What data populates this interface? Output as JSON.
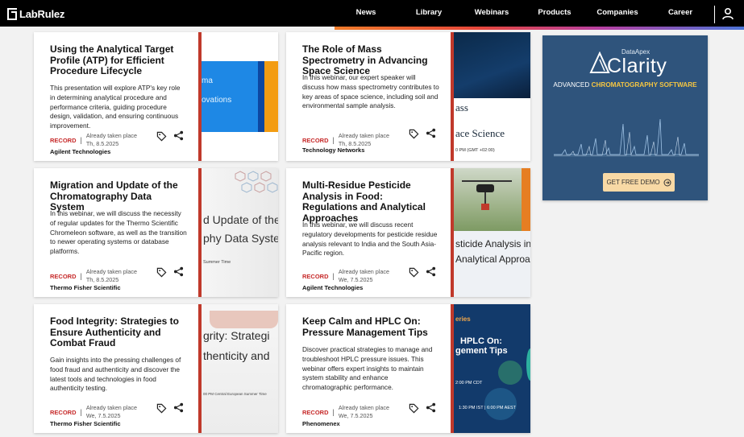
{
  "brand": {
    "name": "LabRulez"
  },
  "nav": {
    "items": [
      "News",
      "Library",
      "Webinars",
      "Products",
      "Companies",
      "Career"
    ]
  },
  "cards": [
    {
      "title": "Using the Analytical Target Profile (ATP) for Efficient Procedure Lifecycle",
      "description": "This presentation will explore ATP's key role in determining analytical procedure and performance criteria, guiding procedure design, validation, and ensuring continuous improvement.",
      "record": "RECORD",
      "taken": "Already taken place",
      "date": "Th, 8.5.2025",
      "company": "Agilent Technologies",
      "thumb": {
        "texts": [
          "ma",
          "ovations"
        ]
      }
    },
    {
      "title": "The Role of Mass Spectrometry in Advancing Space Science",
      "description": "In this webinar, our expert speaker will discuss how mass spectrometry contributes to key areas of space science, including soil and environmental sample analysis.",
      "record": "RECORD",
      "taken": "Already taken place",
      "date": "Th, 8.5.2025",
      "company": "Technology Networks",
      "thumb": {
        "texts": [
          "ass",
          "ace Science",
          "0 PM (GMT +02:00)"
        ]
      }
    },
    {
      "title": "Migration and Update of the Chromatography Data System",
      "description": "In this webinar, we will discuss the necessity of regular updates for the Thermo Scientific Chromeleon software, as well as the transition to newer operating systems or database platforms.",
      "record": "RECORD",
      "taken": "Already taken place",
      "date": "Th, 8.5.2025",
      "company": "Thermo Fisher Scientific",
      "thumb": {
        "texts": [
          "d Update of the",
          "phy Data Syster",
          "Summer Time"
        ]
      }
    },
    {
      "title": "Multi-Residue Pesticide Analysis in Food: Regulations and Analytical Approaches",
      "description": "In this webinar, we will discuss recent regulatory developments for pesticide residue analysis relevant to India and the South Asia-Pacific region.",
      "record": "RECORD",
      "taken": "Already taken place",
      "date": "We, 7.5.2025",
      "company": "Agilent Technologies",
      "thumb": {
        "texts": [
          "sticide Analysis in",
          "Analytical Approac"
        ]
      }
    },
    {
      "title": "Food Integrity: Strategies to Ensure Authenticity and Combat Fraud",
      "description": "Gain insights into the pressing challenges of food fraud and authenticity and discover the latest tools and technologies in food authenticity testing.",
      "record": "RECORD",
      "taken": "Already taken place",
      "date": "We, 7.5.2025",
      "company": "Thermo Fisher Scientific",
      "thumb": {
        "texts": [
          "grity: Strategi",
          "thenticity and",
          "00 PM Central European Summer Time"
        ]
      }
    },
    {
      "title": "Keep Calm and HPLC On: Pressure Management Tips",
      "description": "Discover practical strategies to manage and troubleshoot HPLC pressure issues. This webinar offers expert insights to maintain system stability and enhance chromatographic performance.",
      "record": "RECORD",
      "taken": "Already taken place",
      "date": "We, 7.5.2025",
      "company": "Phenomenex",
      "thumb": {
        "texts": [
          "eries",
          "HPLC On:",
          "gement Tips",
          "2:00 PM CDT",
          "1:30 PM IST | 6:00 PM AEST"
        ]
      }
    }
  ],
  "ad": {
    "brand_top": "DataApex",
    "brand": "Clarity",
    "subtitle_pre": "ADVANCED ",
    "subtitle_highlight": "CHROMATOGRAPHY SOFTWARE",
    "button": "GET FREE DEMO"
  },
  "colors": {
    "accent_red": "#c0392b",
    "record_red": "#c62828",
    "ad_bg": "#2f547c"
  }
}
